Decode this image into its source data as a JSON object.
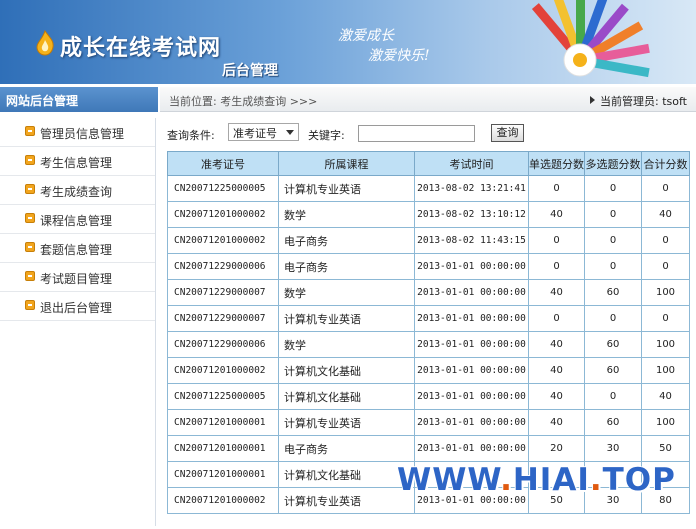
{
  "header": {
    "site_title": "成长在线考试网",
    "subtitle": "后台管理",
    "slogan_line1": "激爱成长",
    "slogan_line2": "激爱快乐!"
  },
  "sidebar": {
    "title": "网站后台管理",
    "items": [
      {
        "label": "管理员信息管理"
      },
      {
        "label": "考生信息管理"
      },
      {
        "label": "考生成绩查询"
      },
      {
        "label": "课程信息管理"
      },
      {
        "label": "套题信息管理"
      },
      {
        "label": "考试题目管理"
      },
      {
        "label": "退出后台管理"
      }
    ]
  },
  "location": {
    "text": "当前位置: 考生成绩查询 >>>",
    "admin": "当前管理员: tsoft"
  },
  "search": {
    "condition_label": "查询条件:",
    "condition_value": "准考证号",
    "keyword_label": "关键字:",
    "keyword_value": "",
    "button_label": "查询"
  },
  "table": {
    "columns": [
      "准考证号",
      "所属课程",
      "考试时间",
      "单选题分数",
      "多选题分数",
      "合计分数"
    ],
    "rows": [
      [
        "CN20071225000005",
        "计算机专业英语",
        "2013-08-02 13:21:41",
        "0",
        "0",
        "0"
      ],
      [
        "CN20071201000002",
        "数学",
        "2013-08-02 13:10:12",
        "40",
        "0",
        "40"
      ],
      [
        "CN20071201000002",
        "电子商务",
        "2013-08-02 11:43:15",
        "0",
        "0",
        "0"
      ],
      [
        "CN20071229000006",
        "电子商务",
        "2013-01-01 00:00:00",
        "0",
        "0",
        "0"
      ],
      [
        "CN20071229000007",
        "数学",
        "2013-01-01 00:00:00",
        "40",
        "60",
        "100"
      ],
      [
        "CN20071229000007",
        "计算机专业英语",
        "2013-01-01 00:00:00",
        "0",
        "0",
        "0"
      ],
      [
        "CN20071229000006",
        "数学",
        "2013-01-01 00:00:00",
        "40",
        "60",
        "100"
      ],
      [
        "CN20071201000002",
        "计算机文化基础",
        "2013-01-01 00:00:00",
        "40",
        "60",
        "100"
      ],
      [
        "CN20071225000005",
        "计算机文化基础",
        "2013-01-01 00:00:00",
        "40",
        "0",
        "40"
      ],
      [
        "CN20071201000001",
        "计算机专业英语",
        "2013-01-01 00:00:00",
        "40",
        "60",
        "100"
      ],
      [
        "CN20071201000001",
        "电子商务",
        "2013-01-01 00:00:00",
        "20",
        "30",
        "50"
      ],
      [
        "CN20071201000001",
        "计算机文化基础",
        "",
        "",
        "",
        ""
      ],
      [
        "CN20071201000002",
        "计算机专业英语",
        "2013-01-01 00:00:00",
        "50",
        "30",
        "80"
      ]
    ]
  },
  "watermark": {
    "text_a": "WWW",
    "text_b": ".",
    "text_c": "HIAI",
    "text_d": ".",
    "text_e": "TOP"
  },
  "colors": {
    "accent": "#3f78b8",
    "table_header": "#bfe0f5",
    "table_border": "#8cb8d5",
    "bullet": "#f2a51d"
  },
  "icons": {
    "logo": "flame-icon",
    "nav_bullet": "square-bullet-icon",
    "admin_marker": "triangle-right-icon",
    "select_caret": "chevron-down-icon"
  }
}
